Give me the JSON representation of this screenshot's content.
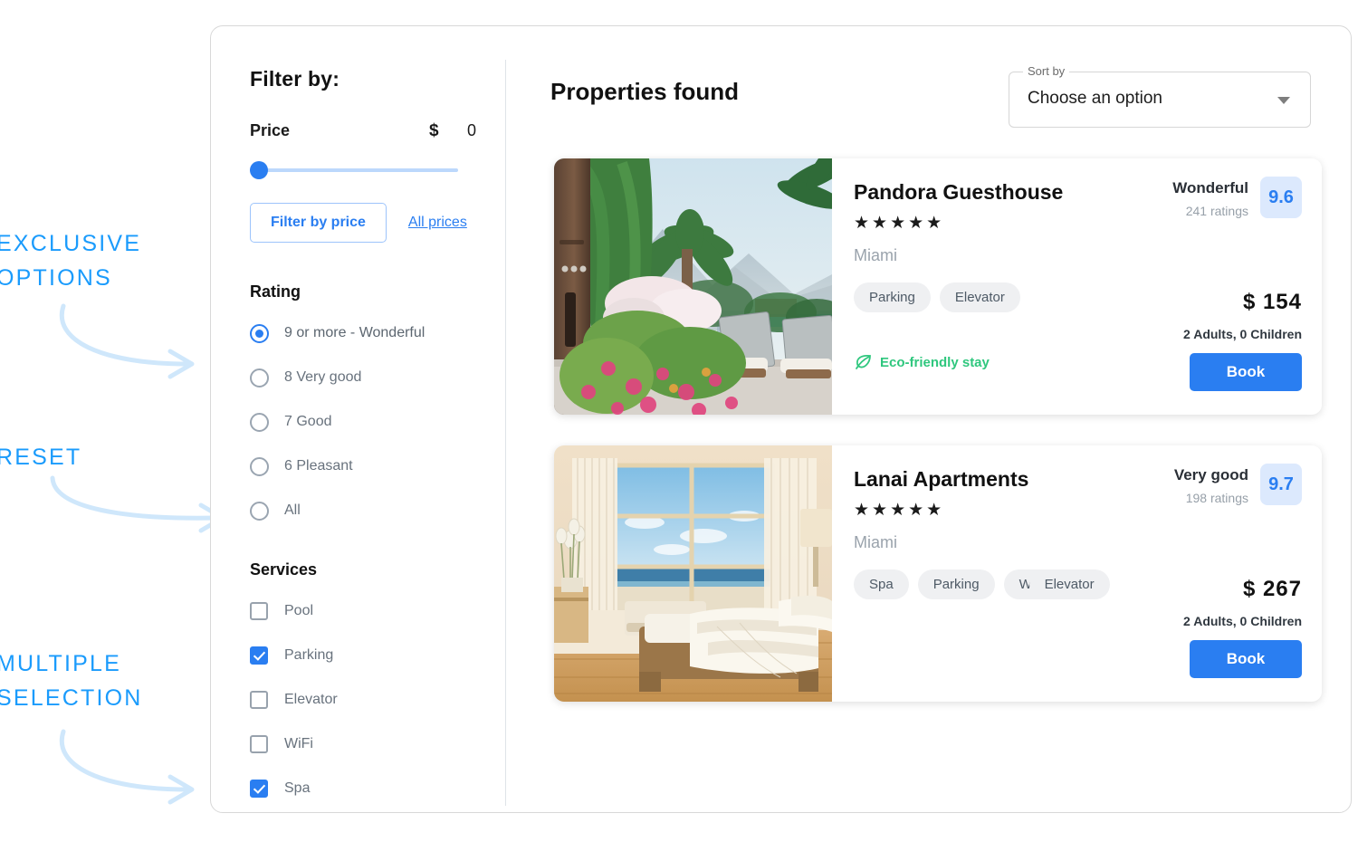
{
  "annotations": [
    {
      "text": "EXCLUSIVE\nOPTIONS",
      "name": "annotation-exclusive-options"
    },
    {
      "text": "RESET",
      "name": "annotation-reset"
    },
    {
      "text": "MULTIPLE\nSELECTION",
      "name": "annotation-multiple-selection"
    }
  ],
  "accent_color": "#2a7ef1",
  "annotation_color": "#1a9bfc",
  "sidebar": {
    "title": "Filter by:",
    "price": {
      "label": "Price",
      "currency": "$",
      "value": "0",
      "slider_position_pct": 0,
      "filter_button": "Filter by price",
      "all_prices_link": "All prices"
    },
    "rating": {
      "title": "Rating",
      "options": [
        {
          "label": "9 or more -  Wonderful",
          "selected": true
        },
        {
          "label": "8 Very good",
          "selected": false
        },
        {
          "label": "7 Good",
          "selected": false
        },
        {
          "label": "6 Pleasant",
          "selected": false
        },
        {
          "label": "All",
          "selected": false
        }
      ]
    },
    "services": {
      "title": "Services",
      "options": [
        {
          "label": "Pool",
          "checked": false
        },
        {
          "label": "Parking",
          "checked": true
        },
        {
          "label": "Elevator",
          "checked": false
        },
        {
          "label": "WiFi",
          "checked": false
        },
        {
          "label": "Spa",
          "checked": true
        }
      ]
    }
  },
  "content": {
    "page_title": "Properties found",
    "sort": {
      "legend": "Sort by",
      "value": "Choose an option"
    },
    "properties": [
      {
        "name": "Pandora Guesthouse",
        "stars": "★★★★★",
        "city": "Miami",
        "chips": [
          "Parking",
          "Elevator"
        ],
        "rating_word": "Wonderful",
        "rating_count": "241 ratings",
        "rating_score": "9.6",
        "price": "$ 154",
        "guests": "2 Adults,  0 Children",
        "book_label": "Book",
        "eco_label": "Eco-friendly stay",
        "has_eco": true,
        "photo": "tropical-terrace-photo"
      },
      {
        "name": "Lanai Apartments",
        "stars": "★★★★★",
        "city": "Miami",
        "chips": [
          "Spa",
          "Parking",
          "WiFi",
          "Elevator"
        ],
        "rating_word": "Very good",
        "rating_count": "198 ratings",
        "rating_score": "9.7",
        "price": "$ 267",
        "guests": "2 Adults,  0 Children",
        "book_label": "Book",
        "eco_label": "",
        "has_eco": false,
        "photo": "beach-bedroom-photo"
      }
    ]
  }
}
